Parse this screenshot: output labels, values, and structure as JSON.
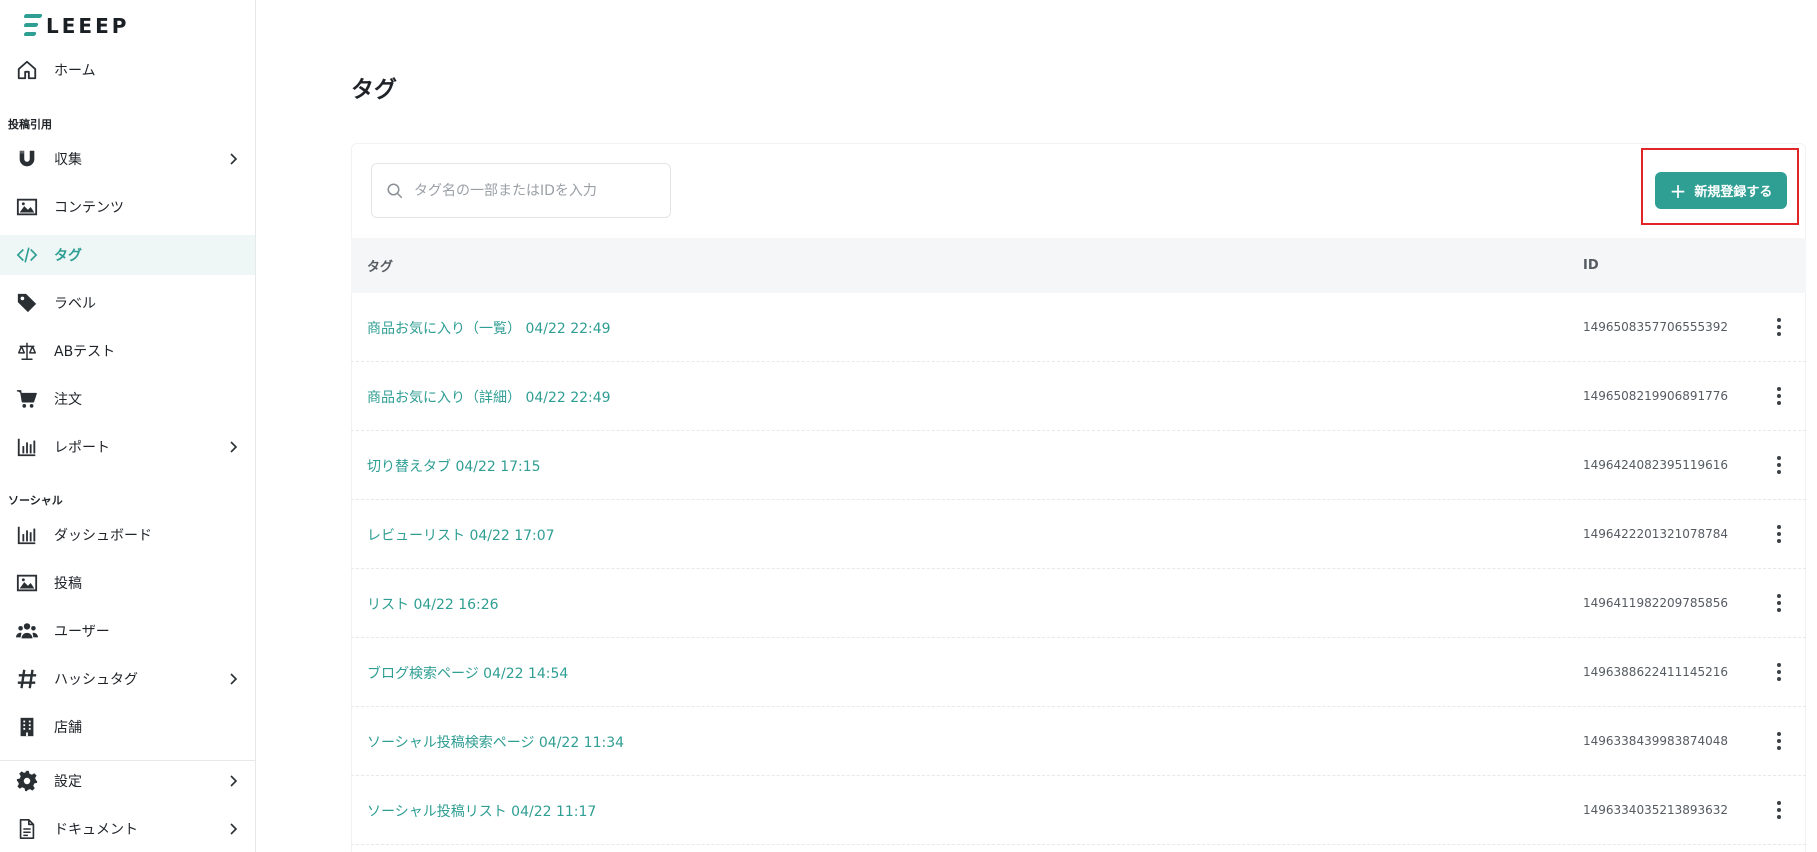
{
  "brand": {
    "logo_text": "LEEEP",
    "accent": "#2f9e93"
  },
  "sidebar": {
    "home": {
      "label": "ホーム",
      "icon": "home-icon"
    },
    "section_posting": "投稿引用",
    "posting_items": [
      {
        "label": "収集",
        "icon": "magnet-icon",
        "has_children": true
      },
      {
        "label": "コンテンツ",
        "icon": "image-icon",
        "has_children": false
      },
      {
        "label": "タグ",
        "icon": "code-icon",
        "has_children": false,
        "active": true
      },
      {
        "label": "ラベル",
        "icon": "tag-icon",
        "has_children": false
      },
      {
        "label": "ABテスト",
        "icon": "scale-icon",
        "has_children": false
      },
      {
        "label": "注文",
        "icon": "cart-icon",
        "has_children": false
      },
      {
        "label": "レポート",
        "icon": "bar-chart-icon",
        "has_children": true
      }
    ],
    "section_social": "ソーシャル",
    "social_items": [
      {
        "label": "ダッシュボード",
        "icon": "bar-chart-icon",
        "has_children": false
      },
      {
        "label": "投稿",
        "icon": "image-icon",
        "has_children": false
      },
      {
        "label": "ユーザー",
        "icon": "users-icon",
        "has_children": false
      },
      {
        "label": "ハッシュタグ",
        "icon": "hashtag-icon",
        "has_children": true
      },
      {
        "label": "店舗",
        "icon": "building-icon",
        "has_children": false
      }
    ],
    "bottom_items": [
      {
        "label": "設定",
        "icon": "gear-icon",
        "has_children": true
      },
      {
        "label": "ドキュメント",
        "icon": "document-icon",
        "has_children": true
      }
    ]
  },
  "main": {
    "title": "タグ",
    "search": {
      "placeholder": "タグ名の一部またはIDを入力",
      "value": ""
    },
    "add_button_label": "新規登録する",
    "table": {
      "columns": [
        "タグ",
        "ID"
      ],
      "rows": [
        {
          "name": "商品お気に入り（一覧） 04/22 22:49",
          "id": "1496508357706555392"
        },
        {
          "name": "商品お気に入り（詳細） 04/22 22:49",
          "id": "1496508219906891776"
        },
        {
          "name": "切り替えタブ 04/22 17:15",
          "id": "1496424082395119616"
        },
        {
          "name": "レビューリスト 04/22 17:07",
          "id": "1496422201321078784"
        },
        {
          "name": "リスト 04/22 16:26",
          "id": "1496411982209785856"
        },
        {
          "name": "ブログ検索ページ 04/22 14:54",
          "id": "1496388622411145216"
        },
        {
          "name": "ソーシャル投稿検索ページ 04/22 11:34",
          "id": "1496338439983874048"
        },
        {
          "name": "ソーシャル投稿リスト 04/22 11:17",
          "id": "1496334035213893632"
        }
      ]
    }
  }
}
